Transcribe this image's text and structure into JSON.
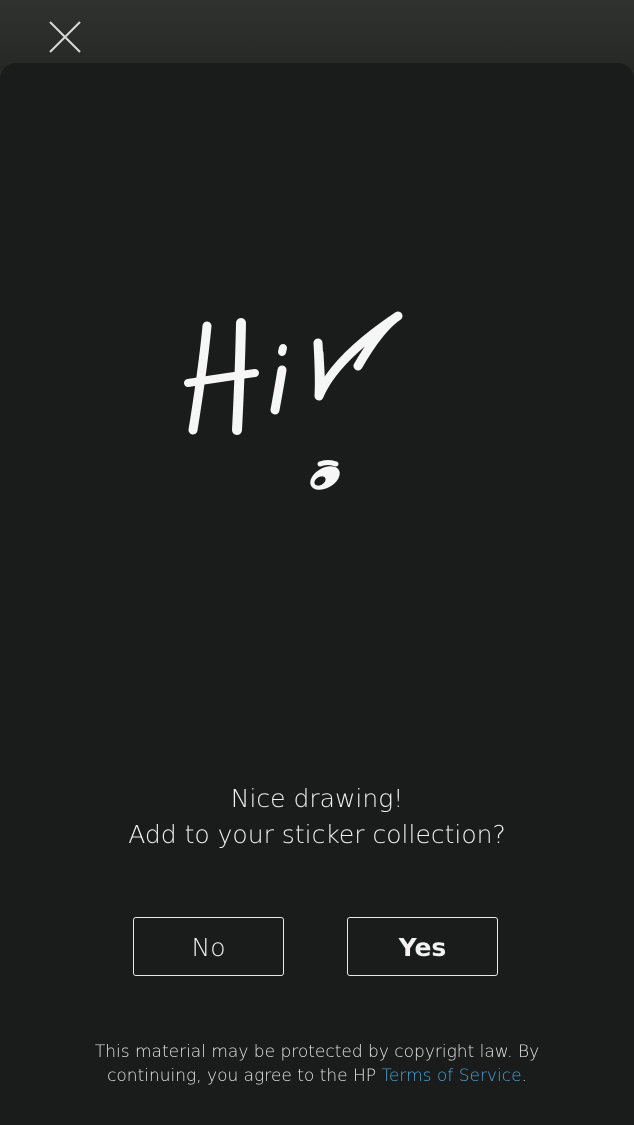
{
  "header": {
    "close_icon": "close-icon"
  },
  "drawing": {
    "description_icon": "handwritten-drawing"
  },
  "prompt": {
    "line1": "Nice drawing!",
    "line2": "Add to your sticker collection?"
  },
  "buttons": {
    "no_label": "No",
    "yes_label": "Yes"
  },
  "legal": {
    "line1": "This material may be protected by copyright law. By",
    "line2_prefix": "continuing, you agree to the HP ",
    "link_text": "Terms of Service",
    "line2_suffix": "."
  },
  "colors": {
    "background": "#1a1b1b",
    "topbar": "#2a2c2b",
    "text": "#f2f2f2",
    "link": "#4aa3d6"
  }
}
